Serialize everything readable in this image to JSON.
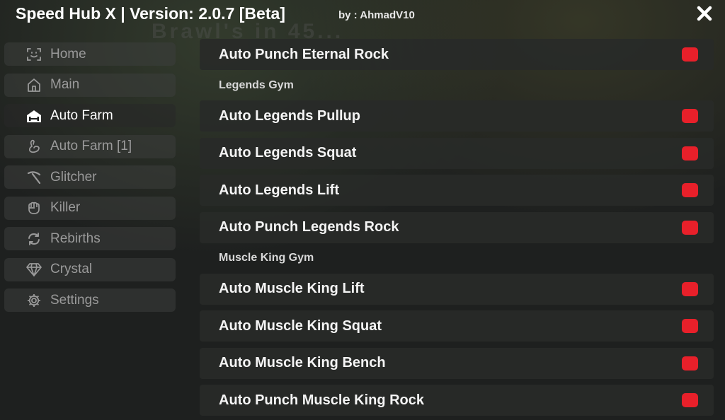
{
  "window": {
    "title": "Speed Hub X | Version: 2.0.7 [Beta]",
    "author": "by : AhmadV10",
    "background_text": "Brawl's   in 45...",
    "accent_color": "#e8202a"
  },
  "sidebar": {
    "items": [
      {
        "label": "Home",
        "icon": "face-scan-icon",
        "active": false
      },
      {
        "label": "Main",
        "icon": "house-icon",
        "active": false
      },
      {
        "label": "Auto Farm",
        "icon": "dumbbell-house-icon",
        "active": true
      },
      {
        "label": "Auto Farm [1]",
        "icon": "flex-arm-icon",
        "active": false
      },
      {
        "label": "Glitcher",
        "icon": "pickaxe-icon",
        "active": false
      },
      {
        "label": "Killer",
        "icon": "fist-icon",
        "active": false
      },
      {
        "label": "Rebirths",
        "icon": "refresh-icon",
        "active": false
      },
      {
        "label": "Crystal",
        "icon": "diamond-icon",
        "active": false
      },
      {
        "label": "Settings",
        "icon": "gear-icon",
        "active": false
      }
    ]
  },
  "content": {
    "rows": [
      {
        "type": "toggle",
        "label": "Auto Punch Eternal Rock",
        "state": "off"
      },
      {
        "type": "section",
        "label": "Legends Gym"
      },
      {
        "type": "toggle",
        "label": "Auto Legends Pullup",
        "state": "off"
      },
      {
        "type": "toggle",
        "label": "Auto Legends Squat",
        "state": "off"
      },
      {
        "type": "toggle",
        "label": "Auto Legends Lift",
        "state": "off"
      },
      {
        "type": "toggle",
        "label": "Auto Punch Legends Rock",
        "state": "off"
      },
      {
        "type": "section",
        "label": "Muscle King Gym"
      },
      {
        "type": "toggle",
        "label": "Auto Muscle King Lift",
        "state": "off"
      },
      {
        "type": "toggle",
        "label": "Auto Muscle King Squat",
        "state": "off"
      },
      {
        "type": "toggle",
        "label": "Auto Muscle King Bench",
        "state": "off"
      },
      {
        "type": "toggle",
        "label": "Auto Punch Muscle King Rock",
        "state": "off"
      }
    ]
  }
}
